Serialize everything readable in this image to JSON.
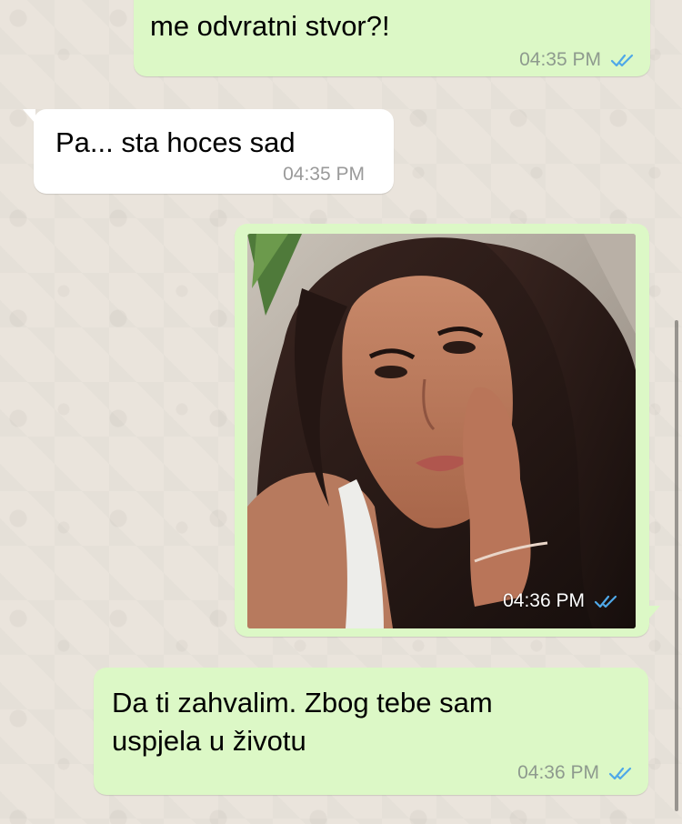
{
  "chat": {
    "messages": [
      {
        "direction": "outgoing",
        "text": "me odvratni stvor?!",
        "time": "04:35 PM",
        "status": "read"
      },
      {
        "direction": "incoming",
        "text": "Pa... sta hoces sad",
        "time": "04:35 PM"
      },
      {
        "direction": "outgoing",
        "type": "photo",
        "time": "04:36 PM",
        "status": "read"
      },
      {
        "direction": "outgoing",
        "text": "Da ti zahvalim. Zbog tebe sam\nuspjela u životu",
        "time": "04:36 PM",
        "status": "read"
      }
    ]
  },
  "colors": {
    "outgoing_bubble": "#DCF8C6",
    "incoming_bubble": "#FFFFFF",
    "read_ticks": "#4FA8E8",
    "wallpaper": "#ECE5DD"
  },
  "icons": {
    "read_status": "double-check-icon"
  }
}
